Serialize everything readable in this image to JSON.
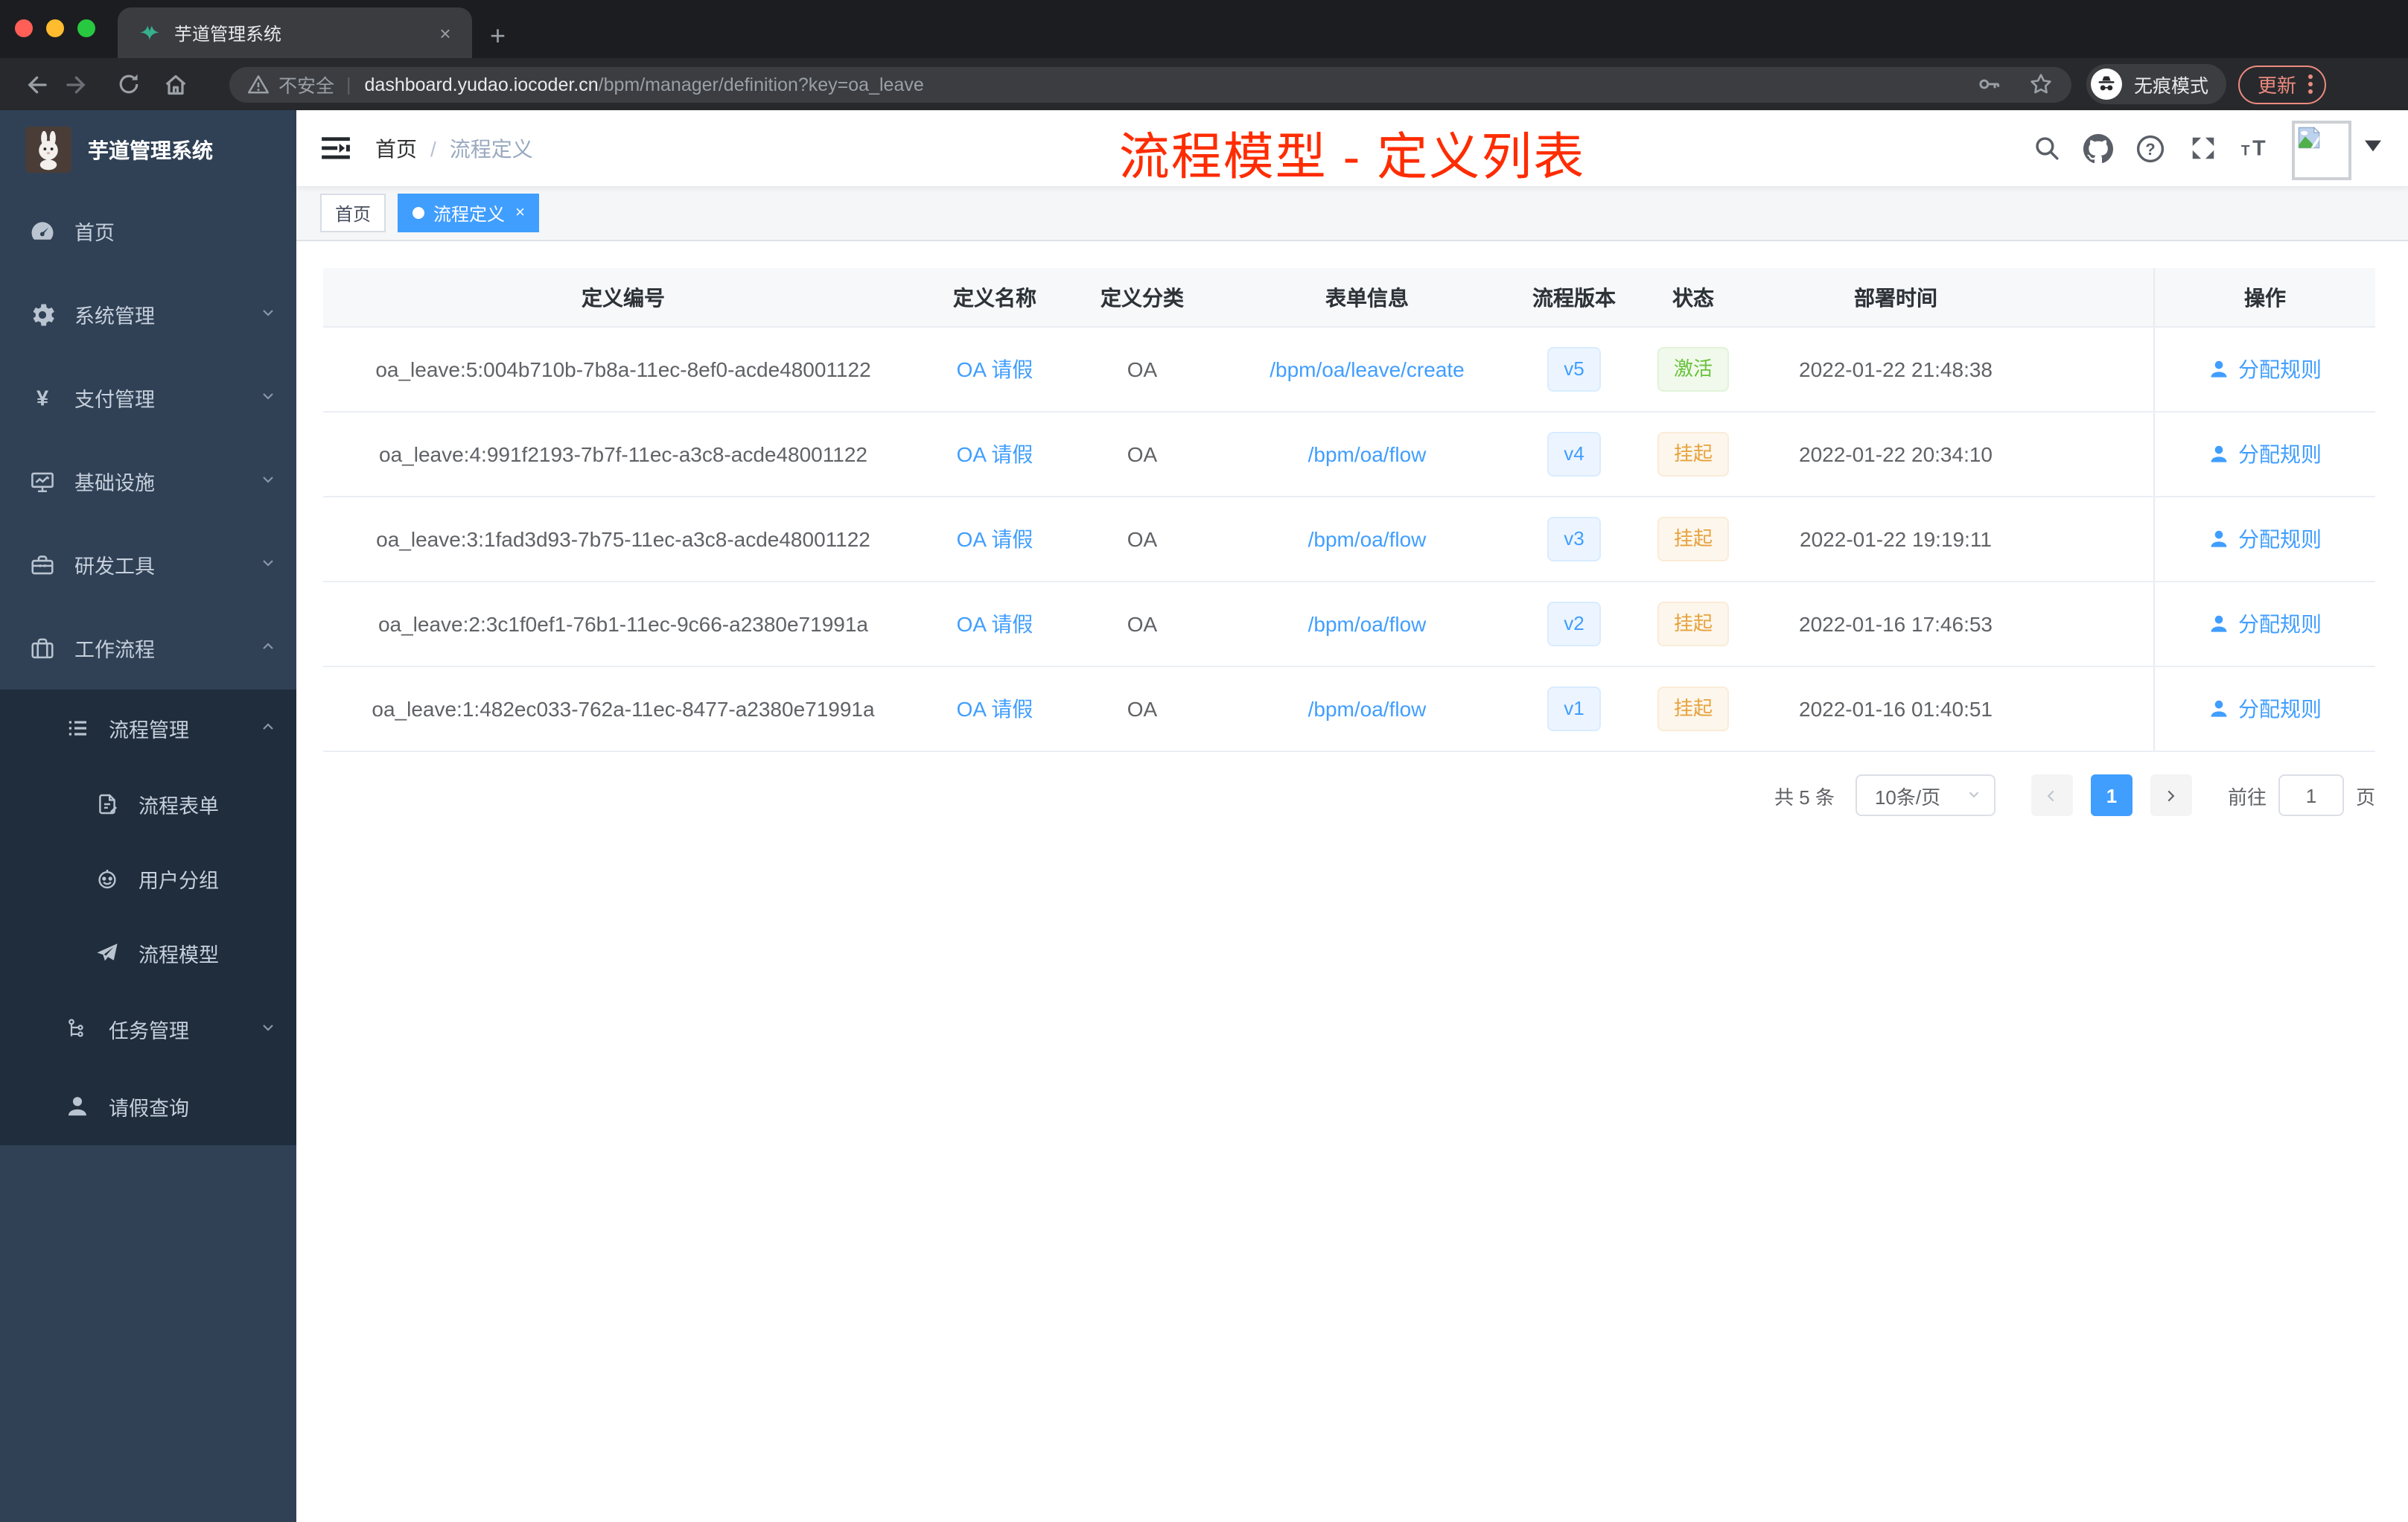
{
  "browser": {
    "tab_title": "芋道管理系统",
    "tab_close": "×",
    "new_tab": "+",
    "security_label": "不安全",
    "url_sep": "|",
    "url_host": "dashboard.yudao.iocoder.cn",
    "url_path": "/bpm/manager/definition?key=oa_leave",
    "incognito_label": "无痕模式",
    "update_label": "更新"
  },
  "sidebar": {
    "title": "芋道管理系统",
    "items": [
      {
        "label": "首页"
      },
      {
        "label": "系统管理"
      },
      {
        "label": "支付管理"
      },
      {
        "label": "基础设施"
      },
      {
        "label": "研发工具"
      },
      {
        "label": "工作流程"
      },
      {
        "label": "流程管理"
      },
      {
        "label": "流程表单"
      },
      {
        "label": "用户分组"
      },
      {
        "label": "流程模型"
      },
      {
        "label": "任务管理"
      },
      {
        "label": "请假查询"
      }
    ]
  },
  "navbar": {
    "breadcrumb_home": "首页",
    "breadcrumb_sep": "/",
    "breadcrumb_current": "流程定义",
    "annotation": "流程模型 - 定义列表"
  },
  "tags": {
    "home": "首页",
    "active": "流程定义",
    "close": "×"
  },
  "table": {
    "columns": [
      "定义编号",
      "定义名称",
      "定义分类",
      "表单信息",
      "流程版本",
      "状态",
      "部署时间",
      "操作"
    ],
    "rows": [
      {
        "id": "oa_leave:5:004b710b-7b8a-11ec-8ef0-acde48001122",
        "name": "OA 请假",
        "category": "OA",
        "form": "/bpm/oa/leave/create",
        "version": "v5",
        "status": "激活",
        "status_type": "success",
        "deploy_time": "2022-01-22 21:48:38",
        "action": "分配规则"
      },
      {
        "id": "oa_leave:4:991f2193-7b7f-11ec-a3c8-acde48001122",
        "name": "OA 请假",
        "category": "OA",
        "form": "/bpm/oa/flow",
        "version": "v4",
        "status": "挂起",
        "status_type": "warning",
        "deploy_time": "2022-01-22 20:34:10",
        "action": "分配规则"
      },
      {
        "id": "oa_leave:3:1fad3d93-7b75-11ec-a3c8-acde48001122",
        "name": "OA 请假",
        "category": "OA",
        "form": "/bpm/oa/flow",
        "version": "v3",
        "status": "挂起",
        "status_type": "warning",
        "deploy_time": "2022-01-22 19:19:11",
        "action": "分配规则"
      },
      {
        "id": "oa_leave:2:3c1f0ef1-76b1-11ec-9c66-a2380e71991a",
        "name": "OA 请假",
        "category": "OA",
        "form": "/bpm/oa/flow",
        "version": "v2",
        "status": "挂起",
        "status_type": "warning",
        "deploy_time": "2022-01-16 17:46:53",
        "action": "分配规则"
      },
      {
        "id": "oa_leave:1:482ec033-762a-11ec-8477-a2380e71991a",
        "name": "OA 请假",
        "category": "OA",
        "form": "/bpm/oa/flow",
        "version": "v1",
        "status": "挂起",
        "status_type": "warning",
        "deploy_time": "2022-01-16 01:40:51",
        "action": "分配规则"
      }
    ]
  },
  "pagination": {
    "total": "共 5 条",
    "page_size": "10条/页",
    "current_page": "1",
    "goto_label": "前往",
    "goto_value": "1",
    "page_unit": "页"
  },
  "colors": {
    "accent": "#409eff",
    "annotation_red": "#fe2c00",
    "status_active_green": "#67c23a",
    "status_suspend_orange": "#e6a23c",
    "sidebar_bg": "#304156",
    "submenu_bg": "#1f2d3d"
  }
}
